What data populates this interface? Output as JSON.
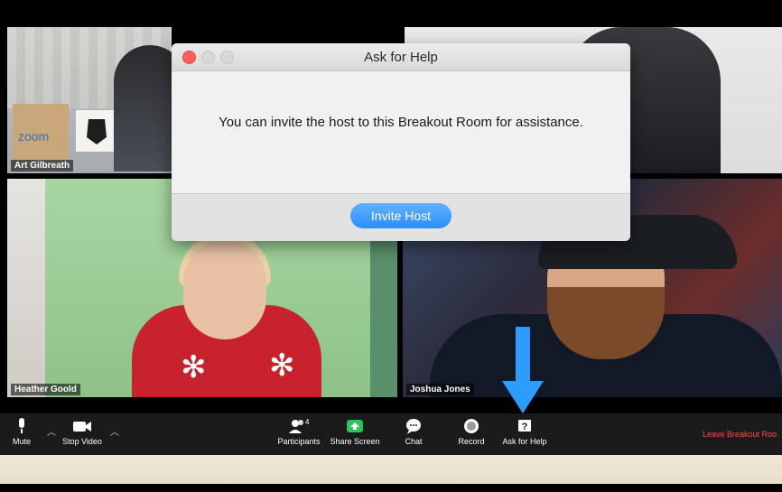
{
  "dialog": {
    "title": "Ask for Help",
    "message": "You can invite the host to this Breakout Room for assistance.",
    "invite_button": "Invite Host"
  },
  "tiles": [
    {
      "name": "Art Gilbreath"
    },
    {
      "name": ""
    },
    {
      "name": "Heather Goold"
    },
    {
      "name": "Joshua Jones"
    }
  ],
  "box_text": "zoom",
  "toolbar": {
    "mute": "Mute",
    "stop_video": "Stop Video",
    "participants": "Participants",
    "participants_count": "4",
    "share_screen": "Share Screen",
    "chat": "Chat",
    "record": "Record",
    "ask_for_help": "Ask for Help",
    "leave": "Leave Breakout Roo"
  },
  "icons": {
    "mute": "microphone-icon",
    "video": "camera-icon",
    "participants": "people-icon",
    "share": "share-screen-icon",
    "chat": "chat-icon",
    "record": "record-icon",
    "help": "question-icon",
    "arrow": "down-arrow-icon"
  },
  "colors": {
    "invite_button": "#2d8cff",
    "leave_text": "#ff4a4a",
    "arrow": "#2e9bff"
  }
}
